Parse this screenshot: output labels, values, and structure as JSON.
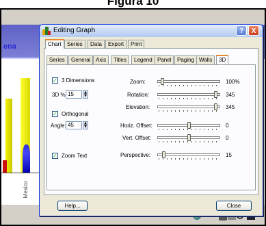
{
  "figure": {
    "caption": "Figura 10"
  },
  "background_app": {
    "header_fragment": "ena",
    "x_axis_label": "Mexico"
  },
  "dialog": {
    "title": "Editing Graph",
    "top_tabs": [
      "Chart",
      "Series",
      "Data",
      "Export",
      "Print"
    ],
    "sub_tabs": [
      "Series",
      "General",
      "Axis",
      "Titles",
      "Legend",
      "Panel",
      "Paging",
      "Walls",
      "3D"
    ],
    "three_d": {
      "dimensions_label": "3 Dimensions",
      "dimensions_checked": true,
      "percent_label": "3D %:",
      "percent_value": "15",
      "orthogonal_label": "Orthogonal",
      "orthogonal_checked": true,
      "angle_label": "Angle:",
      "angle_value": "45",
      "zoom_text_label": "Zoom Text",
      "zoom_text_checked": true
    },
    "sliders": [
      {
        "label": "Zoom:",
        "value": "100%",
        "level": 0.06
      },
      {
        "label": "Rotation:",
        "value": "345",
        "level": 0.95
      },
      {
        "label": "Elevation:",
        "value": "345",
        "level": 0.95
      },
      {
        "label": "Horiz. Offset:",
        "value": "0",
        "level": 0.5
      },
      {
        "label": "Vert. Offset:",
        "value": "0",
        "level": 0.5
      },
      {
        "label": "Perspective:",
        "value": "15",
        "level": 0.08
      }
    ],
    "help_button": "Help...",
    "close_button": "Close",
    "titlebar_help": "?",
    "titlebar_close": "X"
  },
  "icons": [
    "app-icon",
    "help-icon",
    "close-icon",
    "globe-icon",
    "print-icon",
    "page-icon",
    "find-icon",
    "save-icon"
  ]
}
